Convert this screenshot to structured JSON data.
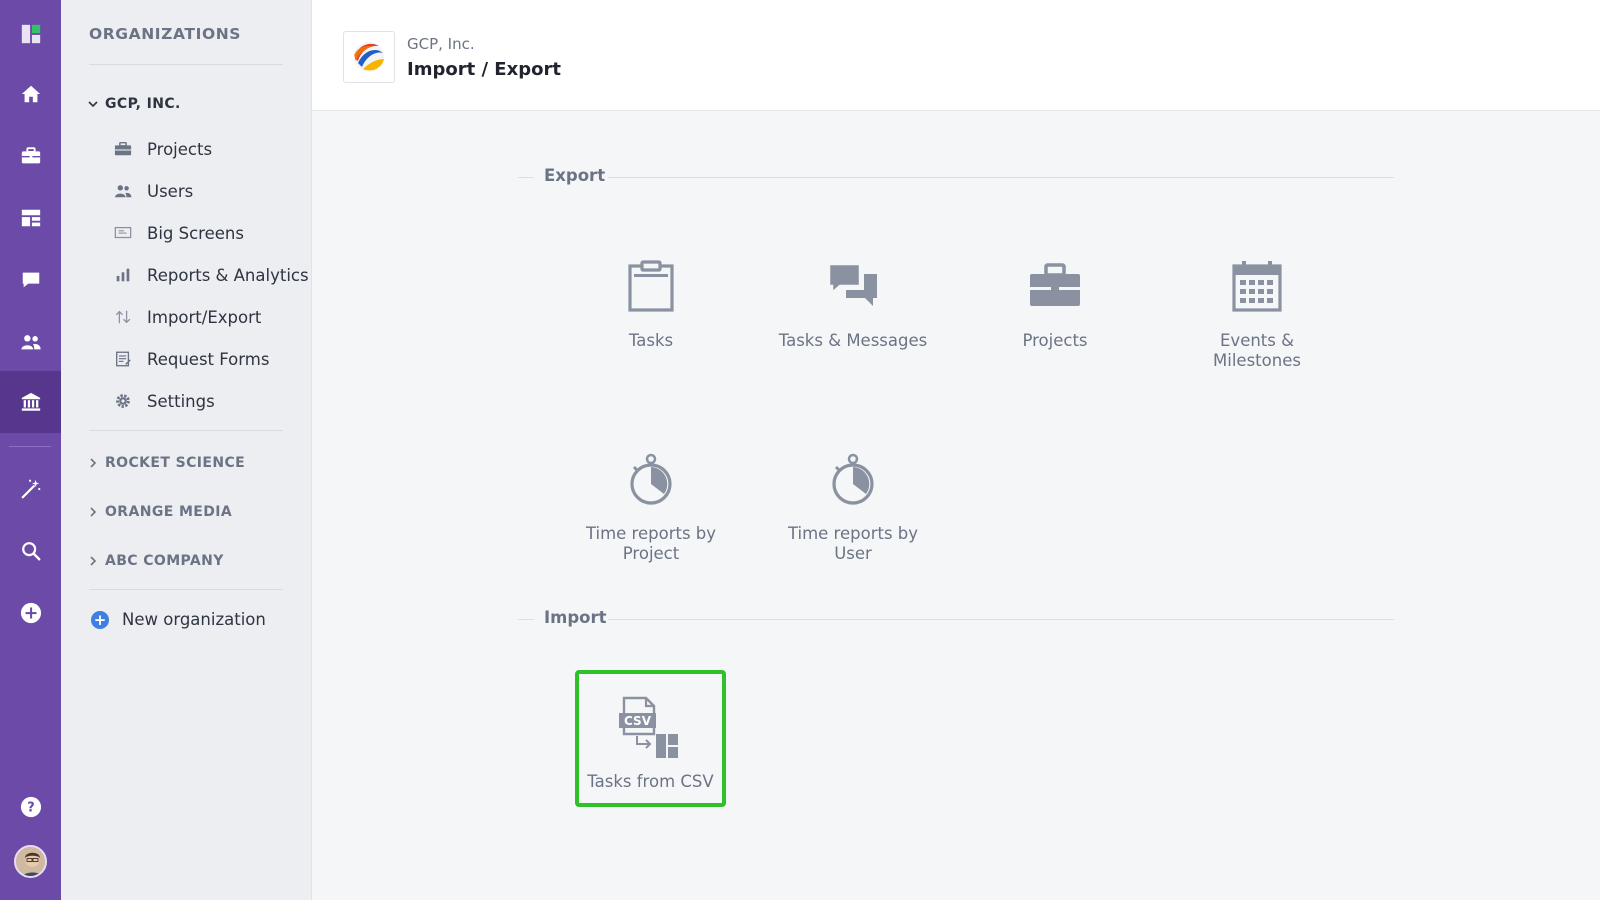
{
  "rail": {
    "items": [
      {
        "icon": "app-logo-icon"
      },
      {
        "icon": "home-icon"
      },
      {
        "icon": "briefcase-icon"
      },
      {
        "icon": "dashboard-icon"
      },
      {
        "icon": "chat-icon"
      },
      {
        "icon": "users-icon"
      },
      {
        "icon": "organization-icon",
        "active": true
      },
      {
        "icon": "magic-wand-icon"
      },
      {
        "icon": "search-icon"
      },
      {
        "icon": "add-circle-icon"
      },
      {
        "icon": "help-icon"
      }
    ],
    "accent": "#6b4aa8",
    "active_bg": "#57378e"
  },
  "sidebar": {
    "title": "ORGANIZATIONS",
    "current_org": "GCP, INC.",
    "items": [
      {
        "label": "Projects",
        "icon": "briefcase-icon"
      },
      {
        "label": "Users",
        "icon": "users-icon"
      },
      {
        "label": "Big Screens",
        "icon": "screen-icon"
      },
      {
        "label": "Reports & Analytics",
        "icon": "bar-chart-icon"
      },
      {
        "label": "Import/Export",
        "icon": "arrows-up-down-icon"
      },
      {
        "label": "Request Forms",
        "icon": "form-icon"
      },
      {
        "label": "Settings",
        "icon": "gear-icon"
      }
    ],
    "other_orgs": [
      "ROCKET SCIENCE",
      "ORANGE MEDIA",
      "ABC COMPANY"
    ],
    "new_org_label": "New organization"
  },
  "header": {
    "org_name": "GCP, Inc.",
    "title": "Import / Export"
  },
  "export": {
    "label": "Export",
    "tiles": [
      {
        "label": "Tasks",
        "icon": "clipboard-icon"
      },
      {
        "label": "Tasks & Messages",
        "icon": "chat-bubbles-icon"
      },
      {
        "label": "Projects",
        "icon": "briefcase-icon"
      },
      {
        "label": "Events & Milestones",
        "icon": "calendar-icon"
      },
      {
        "label": "Time reports by Project",
        "icon": "stopwatch-icon"
      },
      {
        "label": "Time reports by User",
        "icon": "stopwatch-icon"
      }
    ]
  },
  "import": {
    "label": "Import",
    "tiles": [
      {
        "label": "Tasks from CSV",
        "icon": "csv-import-icon",
        "highlight": "#2fc12a"
      }
    ]
  }
}
